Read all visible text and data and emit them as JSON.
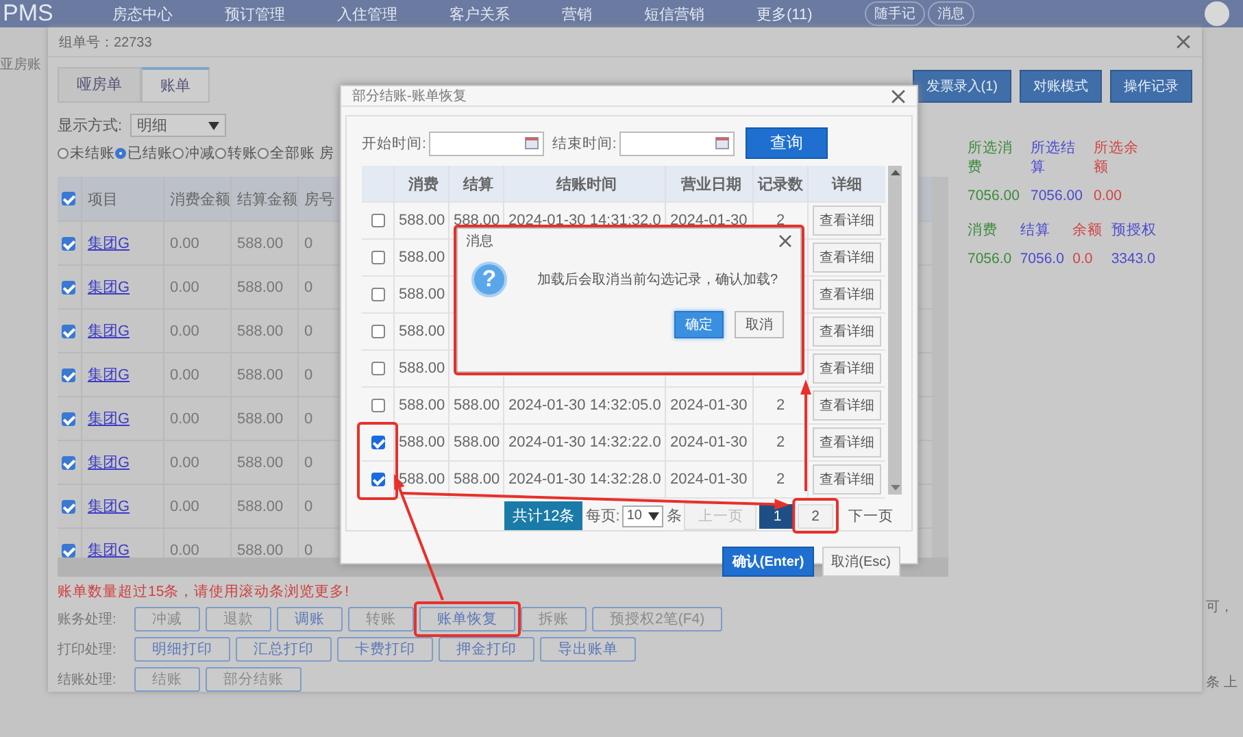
{
  "top_nav": {
    "logo": "PMS",
    "items": [
      "房态中心",
      "预订管理",
      "入住管理",
      "客户关系",
      "营销",
      "短信营销",
      "更多(11)"
    ],
    "pills": [
      "随手记",
      "消息"
    ]
  },
  "background": {
    "side_label": "亚房账",
    "right_texts": [
      "可，",
      "条",
      "上"
    ]
  },
  "group_dialog": {
    "title": "组单号：22733",
    "tabs": [
      {
        "label": "哑房单",
        "selected": false
      },
      {
        "label": "账单",
        "selected": true
      }
    ],
    "top_buttons": [
      "发票录入(1)",
      "对账模式",
      "操作记录"
    ],
    "display_mode": {
      "label": "显示方式:",
      "value": "明细"
    },
    "filters": [
      {
        "label": "未结账",
        "selected": false
      },
      {
        "label": "已结账",
        "selected": true
      },
      {
        "label": "冲减",
        "selected": false
      },
      {
        "label": "转账",
        "selected": false
      },
      {
        "label": "全部账",
        "selected": false
      }
    ],
    "filter_cut": "房",
    "table": {
      "all_checked": true,
      "columns": [
        "项目",
        "消费金额",
        "结算金额",
        "房号"
      ],
      "rows": [
        {
          "checked": true,
          "item": "集团G",
          "consume": "0.00",
          "settle": "588.00",
          "room": "0"
        },
        {
          "checked": true,
          "item": "集团G",
          "consume": "0.00",
          "settle": "588.00",
          "room": "0"
        },
        {
          "checked": true,
          "item": "集团G",
          "consume": "0.00",
          "settle": "588.00",
          "room": "0"
        },
        {
          "checked": true,
          "item": "集团G",
          "consume": "0.00",
          "settle": "588.00",
          "room": "0"
        },
        {
          "checked": true,
          "item": "集团G",
          "consume": "0.00",
          "settle": "588.00",
          "room": "0"
        },
        {
          "checked": true,
          "item": "集团G",
          "consume": "0.00",
          "settle": "588.00",
          "room": "0"
        },
        {
          "checked": true,
          "item": "集团G",
          "consume": "0.00",
          "settle": "588.00",
          "room": "0"
        },
        {
          "checked": true,
          "item": "集团G",
          "consume": "0.00",
          "settle": "588.00",
          "room": "0"
        }
      ]
    },
    "warning": "账单数量超过15条，请使用滚动条浏览更多!",
    "action_groups": [
      {
        "label": "账务处理:",
        "buttons": [
          {
            "label": "冲减",
            "disabled": true,
            "marked": false
          },
          {
            "label": "退款",
            "disabled": true,
            "marked": false
          },
          {
            "label": "调账",
            "disabled": false,
            "marked": false
          },
          {
            "label": "转账",
            "disabled": true,
            "marked": false
          },
          {
            "label": "账单恢复",
            "disabled": false,
            "marked": true
          },
          {
            "label": "拆账",
            "disabled": true,
            "marked": false
          },
          {
            "label": "预授权2笔(F4)",
            "disabled": true,
            "marked": false
          }
        ]
      },
      {
        "label": "打印处理:",
        "buttons": [
          {
            "label": "明细打印",
            "disabled": false,
            "marked": false
          },
          {
            "label": "汇总打印",
            "disabled": false,
            "marked": false
          },
          {
            "label": "卡费打印",
            "disabled": false,
            "marked": false
          },
          {
            "label": "押金打印",
            "disabled": false,
            "marked": false
          },
          {
            "label": "导出账单",
            "disabled": false,
            "marked": false
          }
        ]
      },
      {
        "label": "结账处理:",
        "buttons": [
          {
            "label": "结账",
            "disabled": true,
            "marked": false
          },
          {
            "label": "部分结账",
            "disabled": true,
            "marked": false
          }
        ]
      }
    ],
    "summary": {
      "selected": [
        {
          "label": "所选消费",
          "value": "7056.00",
          "color": "#3c8a3c"
        },
        {
          "label": "所选结算",
          "value": "7056.00",
          "color": "#4a4ad0"
        },
        {
          "label": "所选余额",
          "value": "0.00",
          "color": "#d04444"
        }
      ],
      "totals": [
        {
          "label": "消费",
          "value": "7056.0",
          "color": "#3c8a3c"
        },
        {
          "label": "结算",
          "value": "7056.0",
          "color": "#4a4ad0"
        },
        {
          "label": "余额",
          "value": "0.0",
          "color": "#d04444"
        },
        {
          "label": "预授权",
          "value": "3343.0",
          "color": "#4a4ad0"
        }
      ]
    }
  },
  "restore_dialog": {
    "title": "部分结账-账单恢复",
    "start_label": "开始时间:",
    "end_label": "结束时间:",
    "query_button": "查询",
    "columns": [
      "消费",
      "结算",
      "结账时间",
      "营业日期",
      "记录数",
      "详细"
    ],
    "rows": [
      {
        "checked": false,
        "consume": "588.00",
        "settle": "588.00",
        "time": "2024-01-30 14:31:32.0",
        "date": "2024-01-30",
        "count": "2",
        "detail": "查看详细"
      },
      {
        "checked": false,
        "consume": "588.00",
        "detail": "查看详细"
      },
      {
        "checked": false,
        "consume": "588.00",
        "detail": "查看详细"
      },
      {
        "checked": false,
        "consume": "588.00",
        "detail": "查看详细"
      },
      {
        "checked": false,
        "consume": "588.00",
        "detail": "查看详细"
      },
      {
        "checked": false,
        "consume": "588.00",
        "settle": "588.00",
        "time": "2024-01-30 14:32:05.0",
        "date": "2024-01-30",
        "count": "2",
        "detail": "查看详细"
      },
      {
        "checked": true,
        "marked": true,
        "consume": "588.00",
        "settle": "588.00",
        "time": "2024-01-30 14:32:22.0",
        "date": "2024-01-30",
        "count": "2",
        "detail": "查看详细"
      },
      {
        "checked": true,
        "marked": true,
        "consume": "588.00",
        "settle": "588.00",
        "time": "2024-01-30 14:32:28.0",
        "date": "2024-01-30",
        "count": "2",
        "detail": "查看详细"
      }
    ],
    "pagination": {
      "total": "共计12条",
      "per_page_label": "每页:",
      "per_page": "10",
      "unit": "条",
      "prev": {
        "label": "上一页",
        "disabled": true
      },
      "pages": [
        {
          "label": "1",
          "selected": true
        },
        {
          "label": "2",
          "selected": false,
          "marked": true
        }
      ],
      "next": {
        "label": "下一页",
        "disabled": false
      }
    },
    "confirm_button": "确认(Enter)",
    "cancel_button": "取消(Esc)"
  },
  "message_box": {
    "title": "消息",
    "icon": "?",
    "text": "加载后会取消当前勾选记录，确认加载?",
    "ok": "确定",
    "cancel": "取消",
    "marked": true
  }
}
